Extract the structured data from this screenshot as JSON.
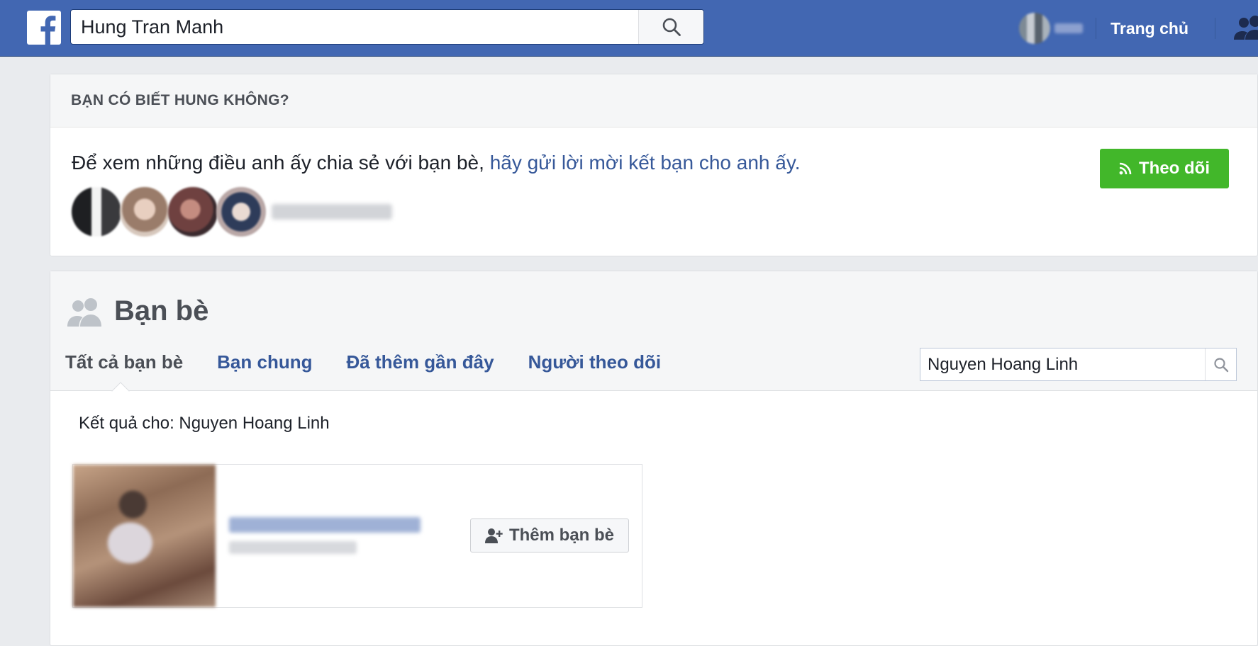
{
  "header": {
    "search_value": "Hung Tran Manh",
    "home_label": "Trang chủ"
  },
  "know_section": {
    "heading": "BẠN CÓ BIẾT HUNG KHÔNG?",
    "message_prefix": "Để xem những điều anh ấy chia sẻ với bạn bè, ",
    "message_link": "hãy gửi lời mời kết bạn cho anh ấy.",
    "follow_label": "Theo dõi"
  },
  "friends_section": {
    "title": "Bạn bè",
    "tabs": [
      {
        "label": "Tất cả bạn bè",
        "active": true
      },
      {
        "label": "Bạn chung",
        "active": false
      },
      {
        "label": "Đã thêm gần đây",
        "active": false
      },
      {
        "label": "Người theo dõi",
        "active": false
      }
    ],
    "search_value": "Nguyen Hoang Linh",
    "results_label": "Kết quả cho: Nguyen Hoang Linh",
    "add_friend_label": "Thêm bạn bè"
  },
  "colors": {
    "brand_blue": "#4267b2",
    "link_blue": "#365899",
    "follow_green": "#42b72a"
  },
  "icons": [
    "facebook-logo-icon",
    "search-icon",
    "friends-icon",
    "rss-icon",
    "add-friend-icon"
  ]
}
